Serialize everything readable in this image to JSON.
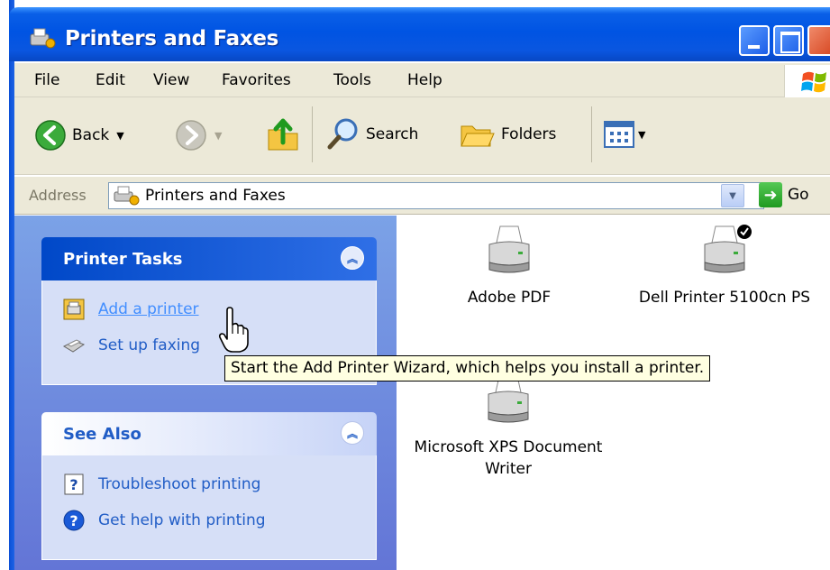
{
  "window": {
    "title": "Printers and Faxes"
  },
  "menu": {
    "items": [
      "File",
      "Edit",
      "View",
      "Favorites",
      "Tools",
      "Help"
    ]
  },
  "toolbar": {
    "back_label": "Back",
    "search_label": "Search",
    "folders_label": "Folders"
  },
  "address": {
    "label": "Address",
    "value": "Printers and Faxes",
    "go_label": "Go"
  },
  "task_pane": {
    "printer_tasks": {
      "title": "Printer Tasks",
      "items": [
        "Add a printer",
        "Set up faxing"
      ]
    },
    "see_also": {
      "title": "See Also",
      "items": [
        "Troubleshoot printing",
        "Get help with printing"
      ]
    }
  },
  "printers": [
    {
      "label": "Adobe PDF",
      "default": false
    },
    {
      "label": "Dell Printer 5100cn PS",
      "default": true
    },
    {
      "label_line1": "Microsoft XPS Document",
      "label_line2": "Writer",
      "default": false
    }
  ],
  "tooltip": {
    "text": "Start the Add Printer Wizard, which helps you install a printer."
  },
  "colors": {
    "title_bar": "#0054e3",
    "task_pane_bg": "#6f8fe0",
    "panel_title": "#215dc6",
    "link": "#215dc6",
    "tooltip_bg": "#ffffe1"
  }
}
